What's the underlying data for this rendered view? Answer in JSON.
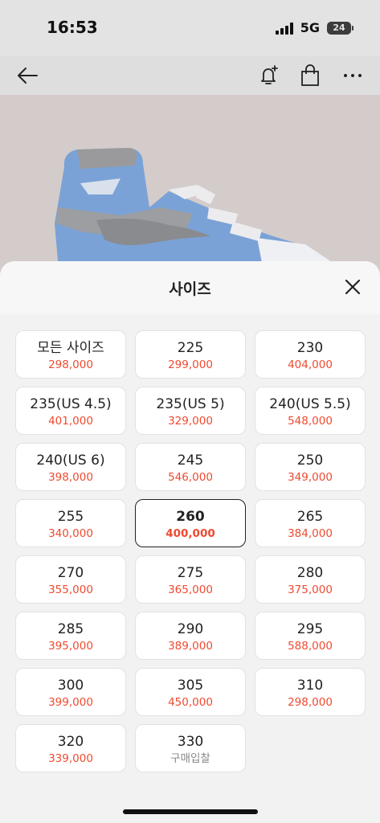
{
  "status": {
    "time": "16:53",
    "network": "5G",
    "battery": "24"
  },
  "nav": {
    "icons": [
      "back-arrow-icon",
      "alarm-add-icon",
      "shopping-bag-icon",
      "more-icon"
    ]
  },
  "sheet": {
    "title": "사이즈",
    "sizes": [
      {
        "label": "모든 사이즈",
        "price": "298,000"
      },
      {
        "label": "225",
        "price": "299,000"
      },
      {
        "label": "230",
        "price": "404,000"
      },
      {
        "label": "235(US 4.5)",
        "price": "401,000"
      },
      {
        "label": "235(US 5)",
        "price": "329,000"
      },
      {
        "label": "240(US 5.5)",
        "price": "548,000"
      },
      {
        "label": "240(US 6)",
        "price": "398,000"
      },
      {
        "label": "245",
        "price": "546,000"
      },
      {
        "label": "250",
        "price": "349,000"
      },
      {
        "label": "255",
        "price": "340,000"
      },
      {
        "label": "260",
        "price": "400,000",
        "selected": true
      },
      {
        "label": "265",
        "price": "384,000"
      },
      {
        "label": "270",
        "price": "355,000"
      },
      {
        "label": "275",
        "price": "365,000"
      },
      {
        "label": "280",
        "price": "375,000"
      },
      {
        "label": "285",
        "price": "395,000"
      },
      {
        "label": "290",
        "price": "389,000"
      },
      {
        "label": "295",
        "price": "588,000"
      },
      {
        "label": "300",
        "price": "399,000"
      },
      {
        "label": "305",
        "price": "450,000"
      },
      {
        "label": "310",
        "price": "298,000"
      },
      {
        "label": "320",
        "price": "339,000"
      },
      {
        "label": "330",
        "price": "구매입찰",
        "muted": true
      }
    ]
  },
  "colors": {
    "price": "#ef4a30",
    "selected_border": "#222222",
    "hero_bg": "#d4cccb"
  }
}
